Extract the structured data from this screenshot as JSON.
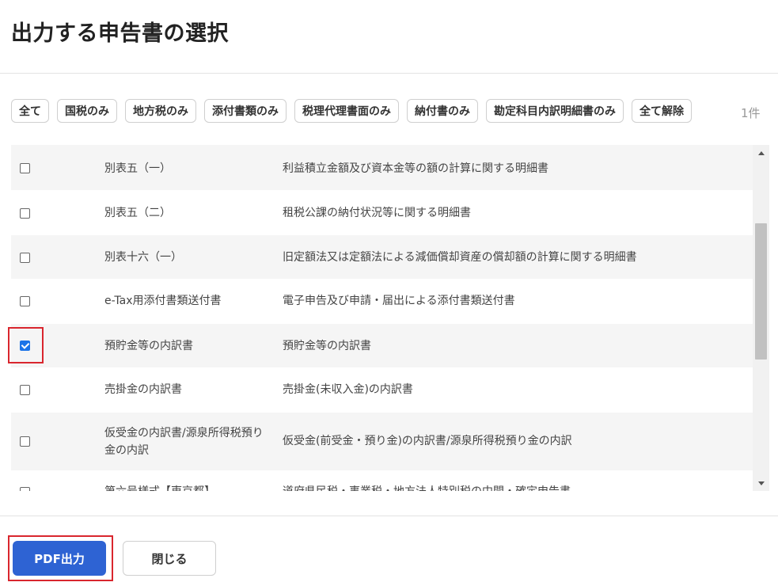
{
  "dialog": {
    "title": "出力する申告書の選択"
  },
  "filters": {
    "chips": [
      "全て",
      "国税のみ",
      "地方税のみ",
      "添付書類のみ",
      "税理代理書面のみ",
      "納付書のみ",
      "勘定科目内訳明細書のみ",
      "全て解除"
    ],
    "count": "1件"
  },
  "list": {
    "rows": [
      {
        "checked": false,
        "name": "別表五（一）",
        "description": "利益積立金額及び資本金等の額の計算に関する明細書"
      },
      {
        "checked": false,
        "name": "別表五（二）",
        "description": "租税公課の納付状況等に関する明細書"
      },
      {
        "checked": false,
        "name": "別表十六（一）",
        "description": "旧定額法又は定額法による減価償却資産の償却額の計算に関する明細書"
      },
      {
        "checked": false,
        "name": "e-Tax用添付書類送付書",
        "description": "電子申告及び申請・届出による添付書類送付書"
      },
      {
        "checked": true,
        "name": "預貯金等の内訳書",
        "description": "預貯金等の内訳書"
      },
      {
        "checked": false,
        "name": "売掛金の内訳書",
        "description": "売掛金(未収入金)の内訳書"
      },
      {
        "checked": false,
        "name": "仮受金の内訳書/源泉所得税預り金の内訳",
        "description": "仮受金(前受金・預り金)の内訳書/源泉所得税預り金の内訳"
      },
      {
        "checked": false,
        "name": "第六号様式【東京都】",
        "description": "道府県民税・事業税・地方法人特別税の中間・確定申告書"
      }
    ]
  },
  "footer": {
    "pdf_button": "PDF出力",
    "close_button": "閉じる"
  }
}
